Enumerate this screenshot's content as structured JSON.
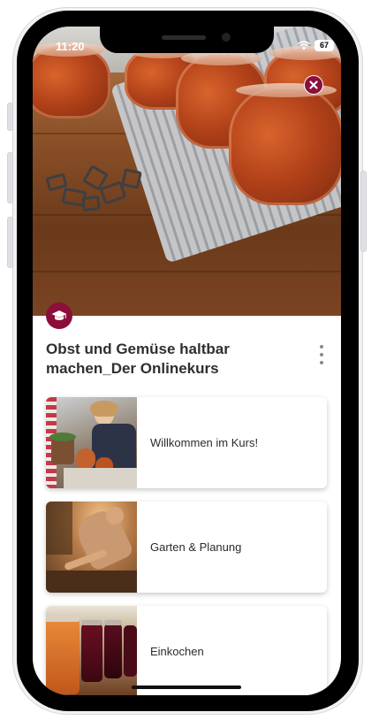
{
  "status_bar": {
    "time": "11:20",
    "battery": "67",
    "wifi_icon": "wifi-icon"
  },
  "hero": {
    "image": "canning-jars-photo",
    "close_icon": "close-icon"
  },
  "course": {
    "badge_icon": "graduation-cap-icon",
    "title": "Obst und Gemüse haltbar machen_Der Onlinekurs",
    "more_icon": "more-vertical-icon"
  },
  "lessons": [
    {
      "label": "Willkommen im Kurs!",
      "thumbnail": "woman-with-jars-thumbnail"
    },
    {
      "label": "Garten & Planung",
      "thumbnail": "garden-soil-thumbnail"
    },
    {
      "label": "Einkochen",
      "thumbnail": "jam-jars-thumbnail"
    }
  ],
  "colors": {
    "accent": "#8b0f3a",
    "title_text": "#2f2f2f",
    "card_background": "#ffffff"
  }
}
